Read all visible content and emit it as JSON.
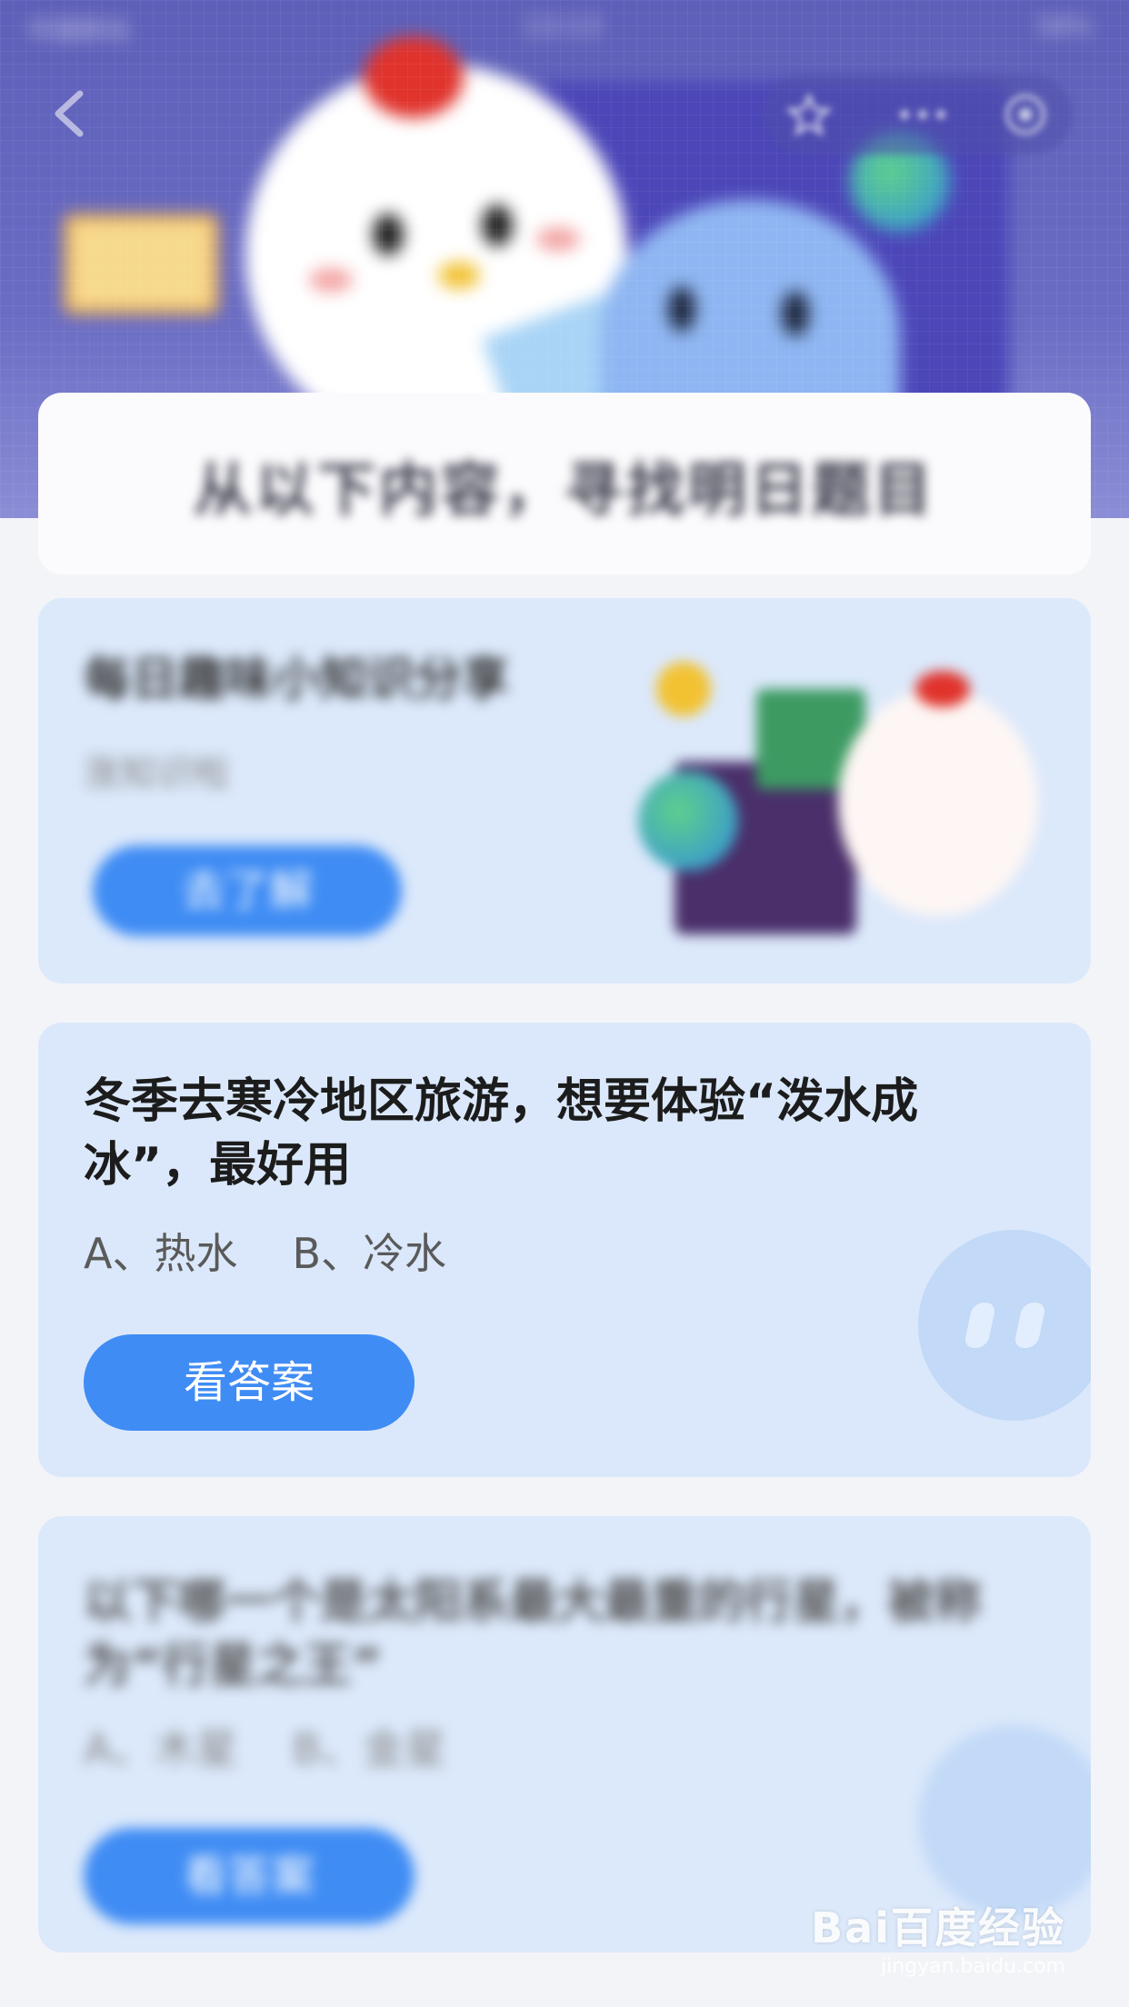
{
  "status_bar": {
    "carrier": "中国移动",
    "time": "13:13",
    "battery": "58%"
  },
  "header": {
    "title": "从以下内容，寻找明日题目"
  },
  "cards": [
    {
      "title": "每日趣味小知识分享",
      "subtitle": "涨知识啦",
      "button": "去了解"
    },
    {
      "question": "冬季去寒冷地区旅游，想要体验“泼水成冰”，最好用",
      "option_a": "A、热水",
      "option_b": "B、冷水",
      "button": "看答案"
    },
    {
      "question": "以下哪一个是太阳系最大最重的行星，被称为“行星之王”",
      "option_a": "A、木星",
      "option_b": "B、金星",
      "button": "看答案"
    }
  ],
  "watermark": {
    "brand": "Bai百度经验",
    "url": "jingyan.baidu.com"
  },
  "colors": {
    "header_bg": "#6a6cc4",
    "card_bg": "#dce9fb",
    "button_bg": "#3f8cf4"
  }
}
